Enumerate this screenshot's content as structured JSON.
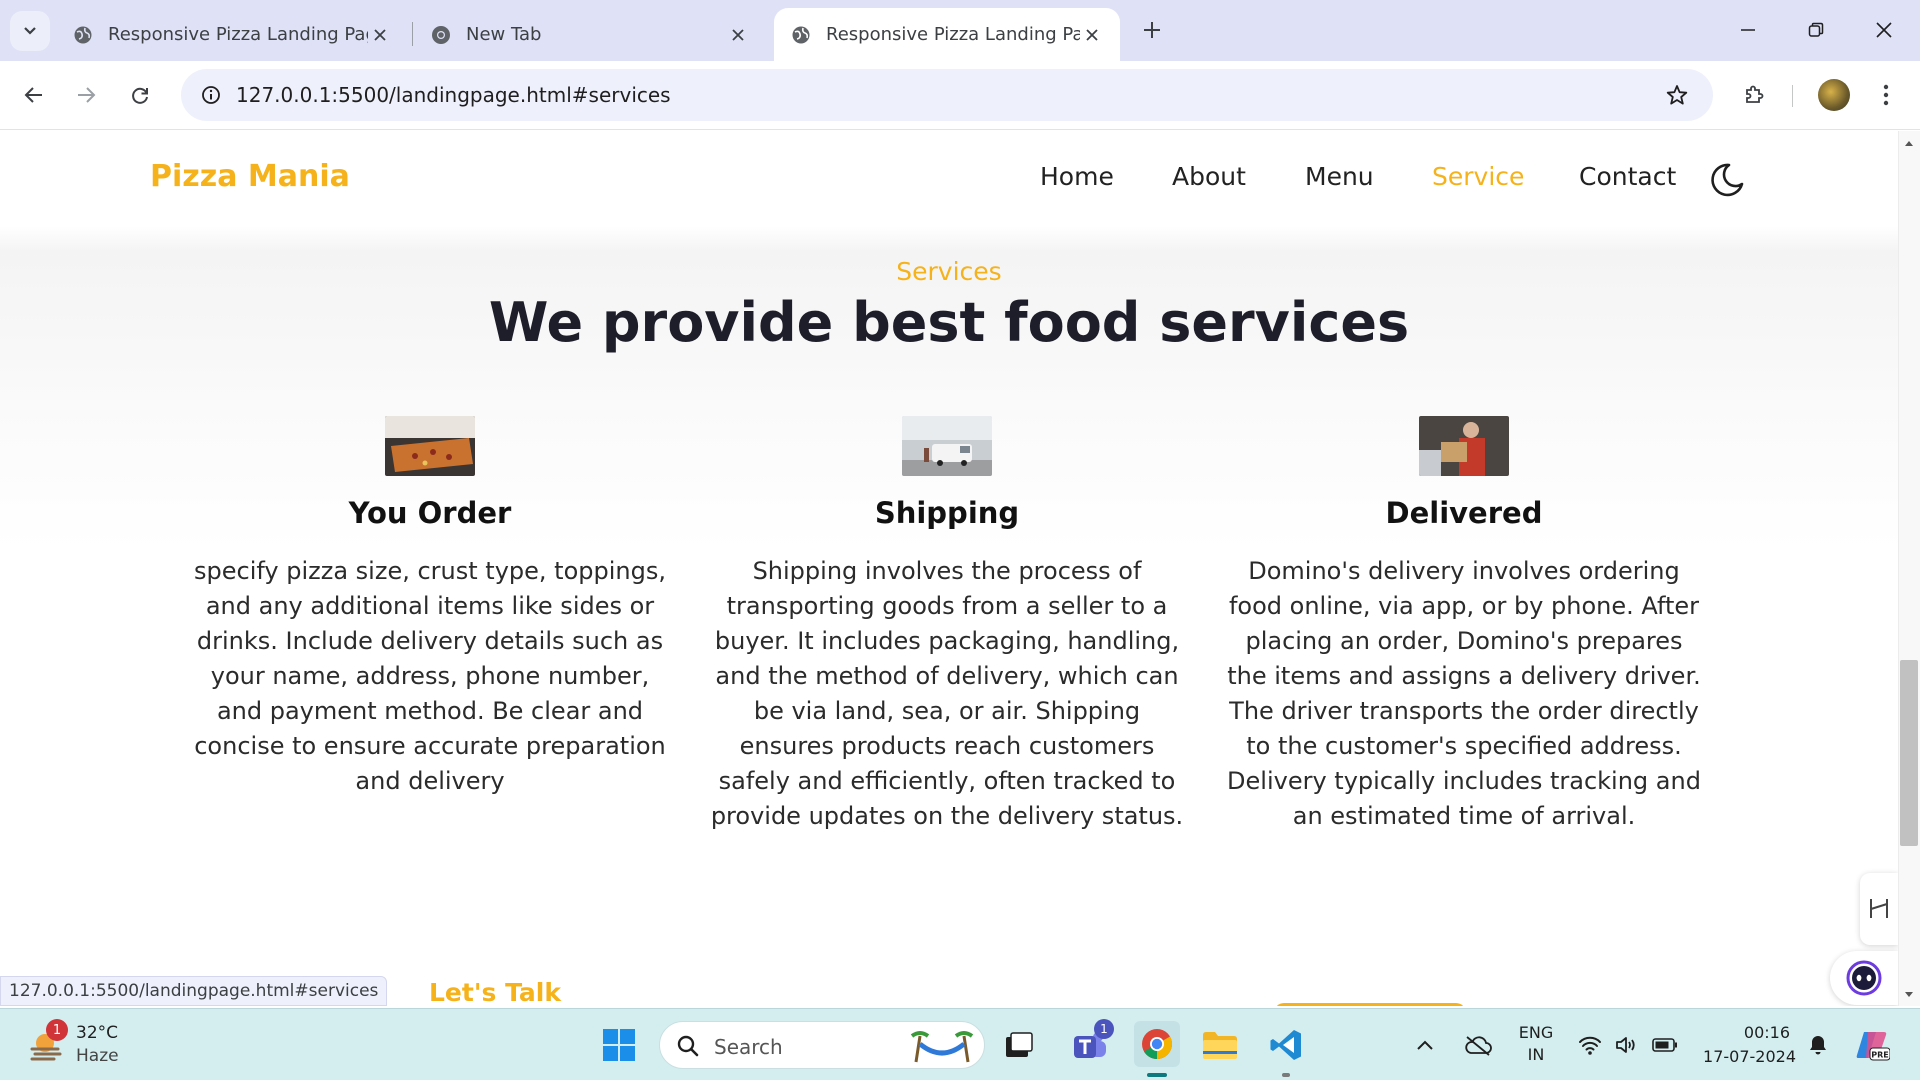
{
  "browser": {
    "tabs": [
      {
        "title": "Responsive Pizza Landing Page",
        "active": false
      },
      {
        "title": "New Tab",
        "active": false
      },
      {
        "title": "Responsive Pizza Landing Page",
        "active": true
      }
    ],
    "url": "127.0.0.1:5500/landingpage.html#services",
    "status_url": "127.0.0.1:5500/landingpage.html#services"
  },
  "site": {
    "logo": "Pizza Mania",
    "nav": [
      "Home",
      "About",
      "Menu",
      "Service",
      "Contact"
    ],
    "active_nav": "Service"
  },
  "services": {
    "eyebrow": "Services",
    "title": "We provide best food services",
    "cards": [
      {
        "title": "You Order",
        "text": "specify pizza size, crust type, toppings, and any additional items like sides or drinks. Include delivery details such as your name, address, phone number, and payment method. Be clear and concise to ensure accurate preparation and delivery"
      },
      {
        "title": "Shipping",
        "text": "Shipping involves the process of transporting goods from a seller to a buyer. It includes packaging, handling, and the method of delivery, which can be via land, sea, or air. Shipping ensures products reach customers safely and efficiently, often tracked to provide updates on the delivery status."
      },
      {
        "title": "Delivered",
        "text": "Domino's delivery involves ordering food online, via app, or by phone. After placing an order, Domino's prepares the items and assigns a delivery driver. The driver transports the order directly to the customer's specified address. Delivery typically includes tracking and an estimated time of arrival."
      }
    ]
  },
  "next_section": {
    "eyebrow": "Let's Talk"
  },
  "taskbar": {
    "weather": {
      "temp": "32°C",
      "desc": "Haze",
      "badge": "1"
    },
    "search_placeholder": "Search",
    "teams_badge": "1",
    "lang": "ENG",
    "region": "IN",
    "time": "00:16",
    "date": "17-07-2024"
  },
  "colors": {
    "accent": "#f5b21b",
    "heading": "#1e1e2a"
  }
}
